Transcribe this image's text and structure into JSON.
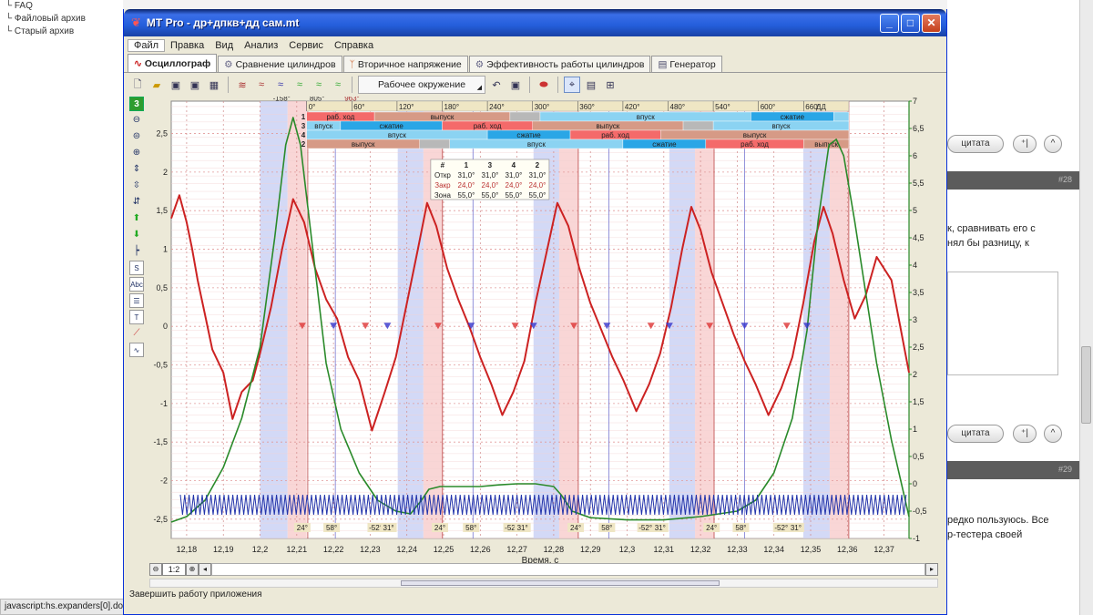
{
  "background": {
    "tree_items": [
      "FAQ",
      "Файловый архив",
      "Старый архив"
    ],
    "post_numbers": [
      "#28",
      "#29"
    ],
    "quote_label": "цитата",
    "text_top": [
      "к, сравнивать его с",
      "нял бы разницу, к"
    ],
    "text_bottom": [
      "редко пользуюсь. Все",
      "р-тестера своей"
    ]
  },
  "browser_status": "javascript:hs.expanders[0].doFullExpand();",
  "window": {
    "title": "MT Pro - др+дпкв+дд сам.mt",
    "menu": [
      "Файл",
      "Правка",
      "Вид",
      "Анализ",
      "Сервис",
      "Справка"
    ],
    "tabs": [
      "Осциллограф",
      "Сравнение цилиндров",
      "Вторичное напряжение",
      "Эффективность работы цилиндров",
      "Генератор"
    ],
    "env_label": "Рабочее окружение",
    "channel_num": "3",
    "zoom_label": "1:2",
    "status": "Завершить работу приложения"
  },
  "chart_data": {
    "type": "line",
    "xlabel": "Время, с",
    "x_ticks": [
      "12,18",
      "12,19",
      "12,2",
      "12,21",
      "12,22",
      "12,23",
      "12,24",
      "12,25",
      "12,26",
      "12,27",
      "12,28",
      "12,29",
      "12,3",
      "12,31",
      "12,32",
      "12,33",
      "12,34",
      "12,35",
      "12,36",
      "12,37"
    ],
    "xlim": [
      12.1758,
      12.3768
    ],
    "y_left_ticks": [
      2.5,
      2,
      1.5,
      1,
      0.5,
      0,
      -0.5,
      -1,
      -1.5,
      -2,
      -2.5
    ],
    "y_left_labels": [
      "2,5",
      "2",
      "1,5",
      "1",
      "0,5",
      "0",
      "-0,5",
      "-1",
      "-1,5",
      "-2",
      "-2,5"
    ],
    "y_left_range": [
      -2.75,
      2.92
    ],
    "y_right_ticks": [
      7,
      6.5,
      6,
      5.5,
      5,
      4.5,
      4,
      3.5,
      3,
      2.5,
      2,
      1.5,
      1,
      0.5,
      0,
      -0.5,
      -1
    ],
    "y_right_labels": [
      "7",
      "6,5",
      "6",
      "5,5",
      "5",
      "4,5",
      "4",
      "3,5",
      "3",
      "2,5",
      "2",
      "1,5",
      "1",
      "0,5",
      "0",
      "-0,5",
      "-1"
    ],
    "y_right_range": [
      -1,
      7
    ],
    "markers": [
      "-158°",
      "805°",
      "963°"
    ],
    "dd_label": "ДД",
    "angle_ticks": [
      "0°",
      "60°",
      "120°",
      "180°",
      "240°",
      "300°",
      "360°",
      "420°",
      "480°",
      "540°",
      "600°",
      "660°"
    ],
    "angle_range": [
      0,
      720
    ],
    "phase_rows": [
      {
        "cyl": "1",
        "segments": [
          [
            0,
            90,
            "раб. ход",
            "#f46a6a"
          ],
          [
            90,
            270,
            "выпуск",
            "#d69a86"
          ],
          [
            270,
            310,
            "",
            "#b8b8b8"
          ],
          [
            310,
            590,
            "впуск",
            "#8bd3f2"
          ],
          [
            590,
            700,
            "сжатие",
            "#2aa6e6"
          ],
          [
            700,
            720,
            "",
            "#8bd3f2"
          ]
        ]
      },
      {
        "cyl": "3",
        "segments": [
          [
            0,
            45,
            "впуск",
            "#8bd3f2"
          ],
          [
            45,
            180,
            "сжатие",
            "#2aa6e6"
          ],
          [
            180,
            300,
            "раб. ход",
            "#f46a6a"
          ],
          [
            300,
            500,
            "выпуск",
            "#d69a86"
          ],
          [
            500,
            540,
            "",
            "#b8b8b8"
          ],
          [
            540,
            720,
            "впуск",
            "#8bd3f2"
          ]
        ]
      },
      {
        "cyl": "4",
        "segments": [
          [
            0,
            240,
            "впуск",
            "#8bd3f2"
          ],
          [
            240,
            350,
            "сжатие",
            "#2aa6e6"
          ],
          [
            350,
            470,
            "раб. ход",
            "#f46a6a"
          ],
          [
            470,
            720,
            "выпуск",
            "#d69a86"
          ]
        ]
      },
      {
        "cyl": "2",
        "segments": [
          [
            0,
            150,
            "выпуск",
            "#d69a86"
          ],
          [
            150,
            190,
            "",
            "#b8b8b8"
          ],
          [
            190,
            420,
            "впуск",
            "#8bd3f2"
          ],
          [
            420,
            530,
            "сжатие",
            "#2aa6e6"
          ],
          [
            530,
            660,
            "раб. ход",
            "#f46a6a"
          ],
          [
            660,
            720,
            "выпуск",
            "#d69a86"
          ]
        ]
      }
    ],
    "valve_table": {
      "headers": [
        "#",
        "1",
        "3",
        "4",
        "2"
      ],
      "rows": [
        [
          "Откр",
          "31,0°",
          "31,0°",
          "31,0°",
          "31,0°"
        ],
        [
          "Закр",
          "24,0°",
          "24,0°",
          "24,0°",
          "24,0°"
        ],
        [
          "Зона",
          "55,0°",
          "55,0°",
          "55,0°",
          "55,0°"
        ]
      ]
    },
    "bottom_labels": [
      "24°",
      "58°",
      "-52°",
      "31°",
      "24°",
      "58°",
      "-52°",
      "31°",
      "24°",
      "58°",
      "-52°",
      "31°",
      "24°",
      "58°",
      "-52°",
      "31°"
    ],
    "series": [
      {
        "color": "#cc2222",
        "points": [
          [
            12.1758,
            1.4
          ],
          [
            12.178,
            1.7
          ],
          [
            12.18,
            1.35
          ],
          [
            12.1815,
            1.0
          ],
          [
            12.183,
            0.6
          ],
          [
            12.185,
            0.15
          ],
          [
            12.187,
            -0.3
          ],
          [
            12.19,
            -0.6
          ],
          [
            12.1925,
            -1.2
          ],
          [
            12.195,
            -0.85
          ],
          [
            12.198,
            -0.7
          ],
          [
            12.2,
            -0.35
          ],
          [
            12.203,
            0.25
          ],
          [
            12.206,
            1.0
          ],
          [
            12.209,
            1.65
          ],
          [
            12.212,
            1.35
          ],
          [
            12.215,
            0.75
          ],
          [
            12.218,
            0.35
          ],
          [
            12.221,
            0.1
          ],
          [
            12.224,
            -0.4
          ],
          [
            12.227,
            -0.7
          ],
          [
            12.2305,
            -1.35
          ],
          [
            12.234,
            -0.85
          ],
          [
            12.237,
            -0.4
          ],
          [
            12.24,
            0.3
          ],
          [
            12.243,
            1.0
          ],
          [
            12.2455,
            1.6
          ],
          [
            12.248,
            1.3
          ],
          [
            12.251,
            0.75
          ],
          [
            12.254,
            0.35
          ],
          [
            12.257,
            0.0
          ],
          [
            12.26,
            -0.4
          ],
          [
            12.263,
            -0.75
          ],
          [
            12.266,
            -1.15
          ],
          [
            12.269,
            -0.85
          ],
          [
            12.272,
            -0.45
          ],
          [
            12.275,
            0.3
          ],
          [
            12.278,
            0.95
          ],
          [
            12.281,
            1.6
          ],
          [
            12.284,
            1.3
          ],
          [
            12.287,
            0.75
          ],
          [
            12.29,
            0.3
          ],
          [
            12.293,
            -0.05
          ],
          [
            12.296,
            -0.4
          ],
          [
            12.299,
            -0.7
          ],
          [
            12.3025,
            -1.1
          ],
          [
            12.306,
            -0.75
          ],
          [
            12.309,
            -0.35
          ],
          [
            12.312,
            0.25
          ],
          [
            12.315,
            1.0
          ],
          [
            12.3175,
            1.55
          ],
          [
            12.32,
            1.25
          ],
          [
            12.323,
            0.7
          ],
          [
            12.326,
            0.3
          ],
          [
            12.329,
            -0.1
          ],
          [
            12.332,
            -0.45
          ],
          [
            12.335,
            -0.75
          ],
          [
            12.3385,
            -1.15
          ],
          [
            12.342,
            -0.8
          ],
          [
            12.345,
            -0.4
          ],
          [
            12.348,
            0.3
          ],
          [
            12.351,
            1.1
          ],
          [
            12.3535,
            1.55
          ],
          [
            12.356,
            1.2
          ],
          [
            12.359,
            0.6
          ],
          [
            12.362,
            0.1
          ],
          [
            12.365,
            0.4
          ],
          [
            12.368,
            0.9
          ],
          [
            12.372,
            0.6
          ],
          [
            12.3768,
            -0.6
          ]
        ]
      },
      {
        "color": "#2a8a2a",
        "points": [
          [
            12.1758,
            -0.7
          ],
          [
            12.18,
            -0.6
          ],
          [
            12.185,
            -0.3
          ],
          [
            12.19,
            0.3
          ],
          [
            12.195,
            1.2
          ],
          [
            12.2,
            2.5
          ],
          [
            12.204,
            4.5
          ],
          [
            12.207,
            6.2
          ],
          [
            12.209,
            6.7
          ],
          [
            12.211,
            6.2
          ],
          [
            12.214,
            4.5
          ],
          [
            12.218,
            2.2
          ],
          [
            12.222,
            1.0
          ],
          [
            12.227,
            0.2
          ],
          [
            12.232,
            -0.3
          ],
          [
            12.237,
            -0.5
          ],
          [
            12.241,
            -0.55
          ],
          [
            12.244,
            -0.3
          ],
          [
            12.246,
            -0.1
          ],
          [
            12.249,
            -0.05
          ],
          [
            12.255,
            -0.05
          ],
          [
            12.26,
            -0.05
          ],
          [
            12.265,
            -0.02
          ],
          [
            12.27,
            0.0
          ],
          [
            12.275,
            0.0
          ],
          [
            12.28,
            -0.05
          ],
          [
            12.282,
            -0.2
          ],
          [
            12.285,
            -0.5
          ],
          [
            12.29,
            -0.62
          ],
          [
            12.3,
            -0.66
          ],
          [
            12.31,
            -0.66
          ],
          [
            12.32,
            -0.6
          ],
          [
            12.33,
            -0.5
          ],
          [
            12.335,
            -0.3
          ],
          [
            12.34,
            0.2
          ],
          [
            12.345,
            1.2
          ],
          [
            12.349,
            2.8
          ],
          [
            12.352,
            4.8
          ],
          [
            12.355,
            6.2
          ],
          [
            12.357,
            6.3
          ],
          [
            12.359,
            6.0
          ],
          [
            12.362,
            4.8
          ],
          [
            12.365,
            3.5
          ],
          [
            12.368,
            2.2
          ],
          [
            12.372,
            0.8
          ],
          [
            12.3768,
            -0.6
          ]
        ]
      }
    ]
  }
}
